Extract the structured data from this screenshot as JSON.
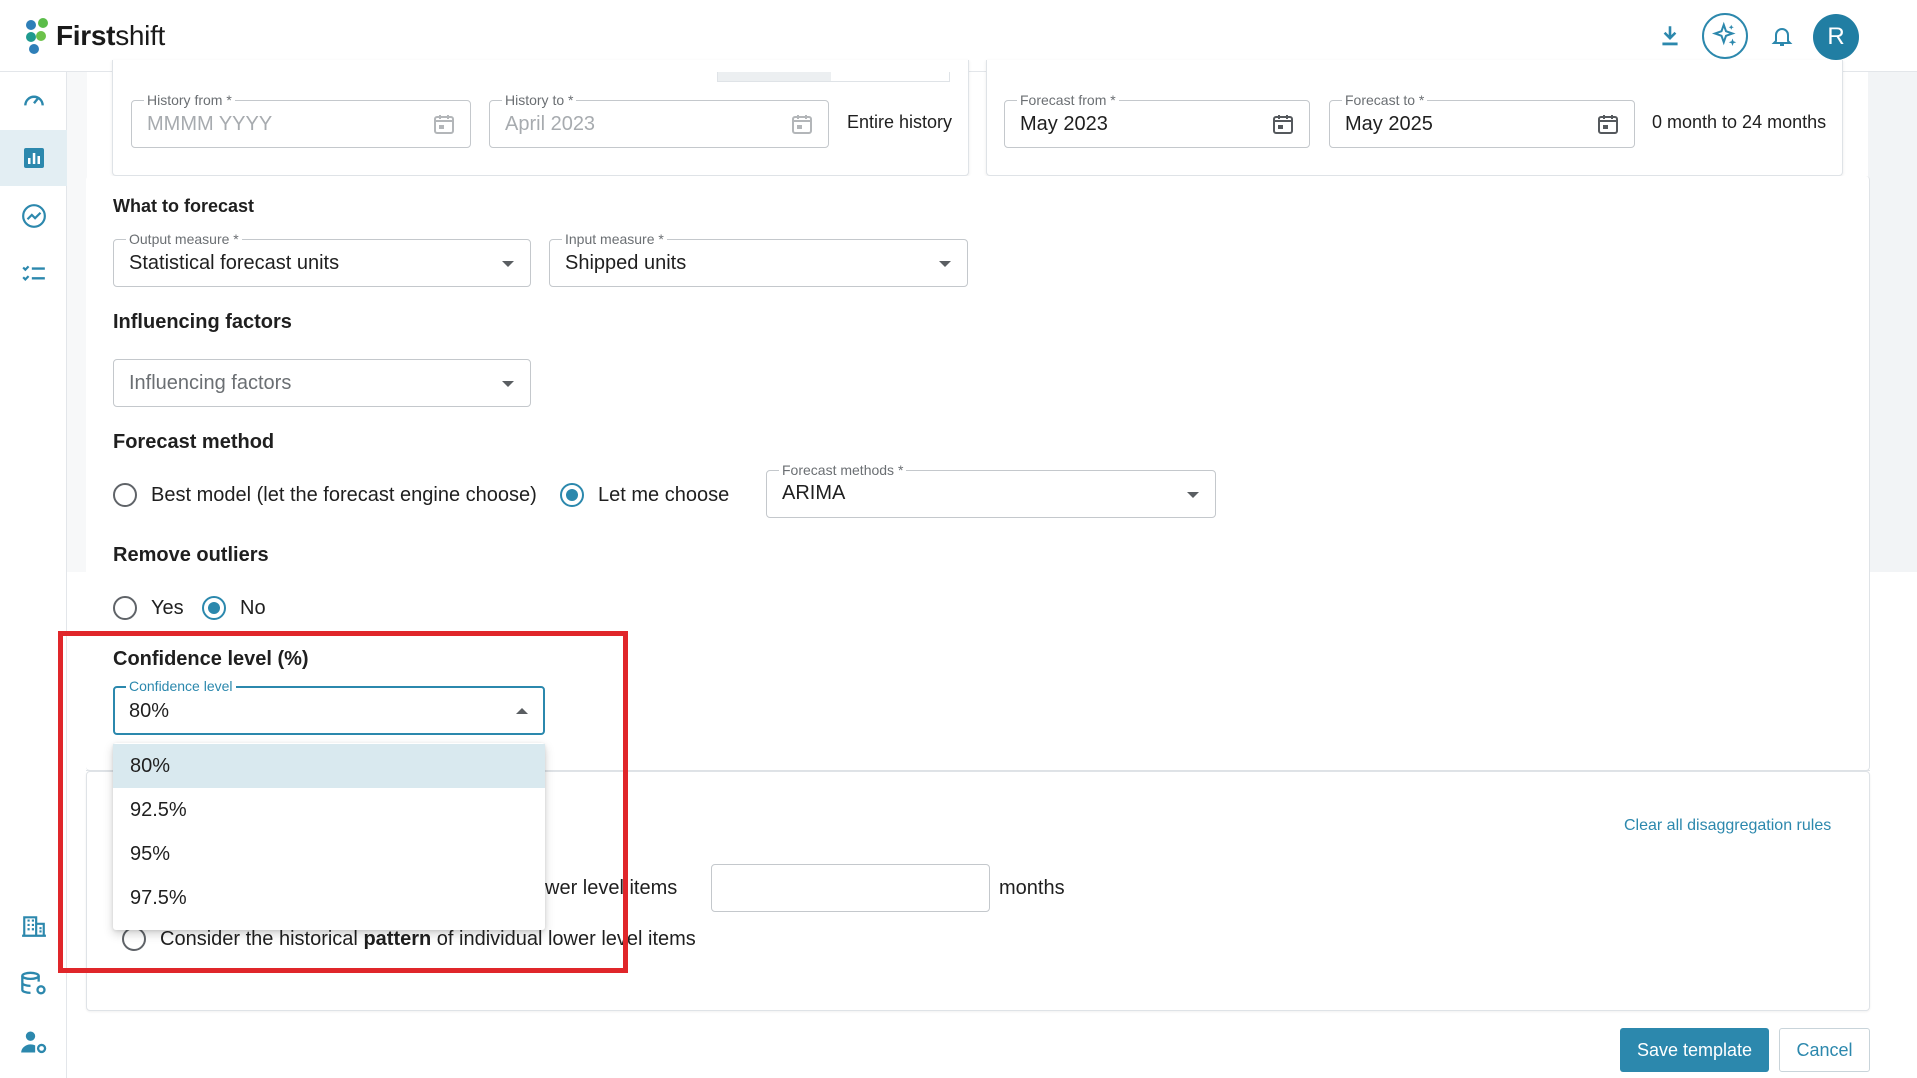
{
  "app": {
    "logo_text_bold": "First",
    "logo_text_rest": "shift",
    "avatar_initial": "R"
  },
  "history": {
    "from_label": "History from *",
    "from_placeholder": "MMMM YYYY",
    "to_label": "History to *",
    "to_value": "April 2023",
    "entire_history": "Entire history"
  },
  "forecast_range": {
    "from_label": "Forecast from *",
    "from_value": "May 2023",
    "to_label": "Forecast to *",
    "to_value": "May 2025",
    "range_text": "0 month to 24 months"
  },
  "what_to_forecast": {
    "title": "What to forecast",
    "output_label": "Output measure *",
    "output_value": "Statistical forecast units",
    "input_label": "Input measure *",
    "input_value": "Shipped units"
  },
  "influencing": {
    "title": "Influencing factors",
    "placeholder": "Influencing factors"
  },
  "forecast_method": {
    "title": "Forecast method",
    "option_best": "Best model (let the forecast engine choose)",
    "option_choose": "Let me choose",
    "methods_label": "Forecast methods *",
    "methods_value": "ARIMA",
    "selected": "choose"
  },
  "outliers": {
    "title": "Remove outliers",
    "yes": "Yes",
    "no": "No",
    "selected": "no"
  },
  "confidence": {
    "title": "Confidence level (%)",
    "label": "Confidence level",
    "value": "80%",
    "options": [
      "80%",
      "92.5%",
      "95%",
      "97.5%"
    ],
    "selected_index": 0
  },
  "disaggregation": {
    "clear_link": "Clear all disaggregation rules",
    "row1_tail": "wer level items",
    "row1_unit": "months",
    "row2_prefix": "Consider the historical ",
    "row2_bold": "pattern",
    "row2_suffix": " of individual lower level items"
  },
  "actions": {
    "save": "Save template",
    "cancel": "Cancel"
  },
  "colors": {
    "accent": "#2c88ad",
    "highlight": "#e0262a",
    "avatar": "#217ea3",
    "selected_option": "#d9e9ef"
  }
}
